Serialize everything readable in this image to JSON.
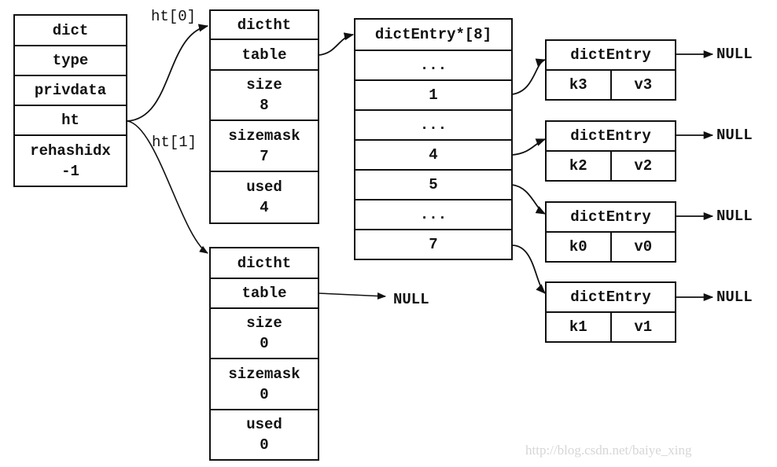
{
  "dict": {
    "title": "dict",
    "fields": [
      "type",
      "privdata",
      "ht"
    ],
    "rehashidx_label": "rehashidx",
    "rehashidx_value": "-1"
  },
  "ht0": {
    "label": "ht[0]",
    "title": "dictht",
    "table": "table",
    "size_label": "size",
    "size_value": "8",
    "sizemask_label": "sizemask",
    "sizemask_value": "7",
    "used_label": "used",
    "used_value": "4"
  },
  "ht1": {
    "label": "ht[1]",
    "title": "dictht",
    "table": "table",
    "table_target": "NULL",
    "size_label": "size",
    "size_value": "0",
    "sizemask_label": "sizemask",
    "sizemask_value": "0",
    "used_label": "used",
    "used_value": "0"
  },
  "bucket_array": {
    "title": "dictEntry*[8]",
    "slots": [
      "...",
      "1",
      "...",
      "4",
      "5",
      "...",
      "7"
    ]
  },
  "entries": [
    {
      "title": "dictEntry",
      "key": "k3",
      "value": "v3",
      "next": "NULL",
      "slot": "1"
    },
    {
      "title": "dictEntry",
      "key": "k2",
      "value": "v2",
      "next": "NULL",
      "slot": "4"
    },
    {
      "title": "dictEntry",
      "key": "k0",
      "value": "v0",
      "next": "NULL",
      "slot": "5"
    },
    {
      "title": "dictEntry",
      "key": "k1",
      "value": "v1",
      "next": "NULL",
      "slot": "7"
    }
  ],
  "watermark": "http://blog.csdn.net/baiye_xing"
}
